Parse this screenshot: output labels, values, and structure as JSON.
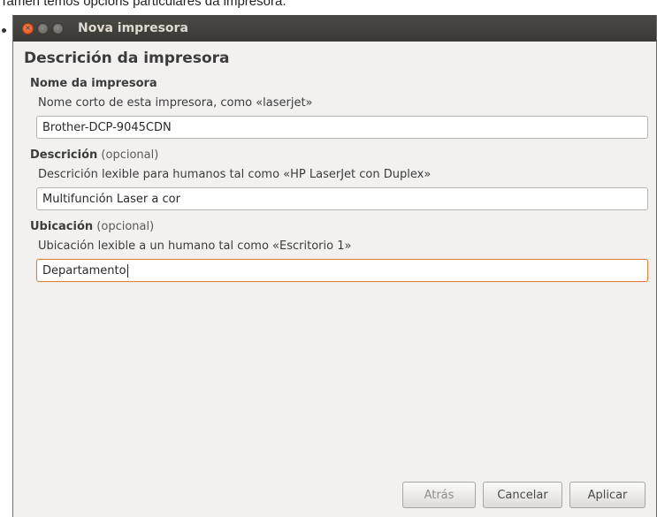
{
  "caption": "Tamén temos opcions particulares da impresora.",
  "window": {
    "title": "Nova impresora"
  },
  "page": {
    "heading": "Descrición da impresora"
  },
  "fields": [
    {
      "title": "Nome da impresora",
      "optional": "",
      "hint": "Nome corto de esta impresora, como «laserjet»",
      "value": "Brother-DCP-9045CDN"
    },
    {
      "title": "Descrición",
      "optional": "(opcional)",
      "hint": "Descrición lexible para humanos tal como «HP LaserJet con Duplex»",
      "value": "Multifunción Laser a cor"
    },
    {
      "title": "Ubicación",
      "optional": "(opcional)",
      "hint": "Ubicación lexible a un humano tal como «Escritorio 1»",
      "value": "Departamento"
    }
  ],
  "buttons": {
    "back": "Atrás",
    "cancel": "Cancelar",
    "apply": "Aplicar"
  },
  "colors": {
    "titlebar": "#3c3b37",
    "window_bg": "#f2f1f0",
    "focus_border": "#e2823f",
    "close_button": "#e8581c"
  }
}
